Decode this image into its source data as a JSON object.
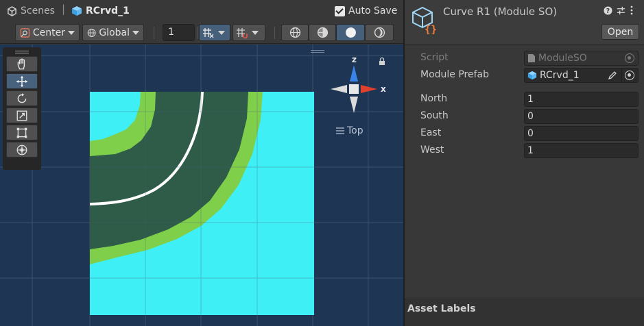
{
  "scene_bar": {
    "scenes_label": "Scenes",
    "separator": "|",
    "prefab_name": "RCrvd_1",
    "autosave_label": "Auto Save",
    "autosave_checked": true
  },
  "toolbar": {
    "pivot_label": "Center",
    "space_label": "Global",
    "grid_size": "1"
  },
  "tool_palette": {
    "tools": [
      "hand-tool",
      "move-tool",
      "rotate-tool",
      "scale-tool",
      "rect-tool",
      "transform-tool"
    ],
    "active": "move-tool"
  },
  "gizmo": {
    "z_label": "z",
    "x_label": "x",
    "view_label": "Top"
  },
  "scene_colors": {
    "background": "#1e3553",
    "tile": "#3ef0f6",
    "road": "#2e5c48",
    "edge": "#7fcf4b",
    "center_line": "#ffffff",
    "grid": "#5b6e86"
  },
  "inspector": {
    "title": "Curve R1 (Module SO)",
    "open_button": "Open",
    "script_label": "Script",
    "script_value": "ModuleSO",
    "module_prefab_label": "Module Prefab",
    "module_prefab_value": "RCrvd_1",
    "fields": [
      {
        "label": "North",
        "value": "1"
      },
      {
        "label": "South",
        "value": "0"
      },
      {
        "label": "East",
        "value": "0"
      },
      {
        "label": "West",
        "value": "1"
      }
    ],
    "asset_labels_title": "Asset Labels"
  }
}
